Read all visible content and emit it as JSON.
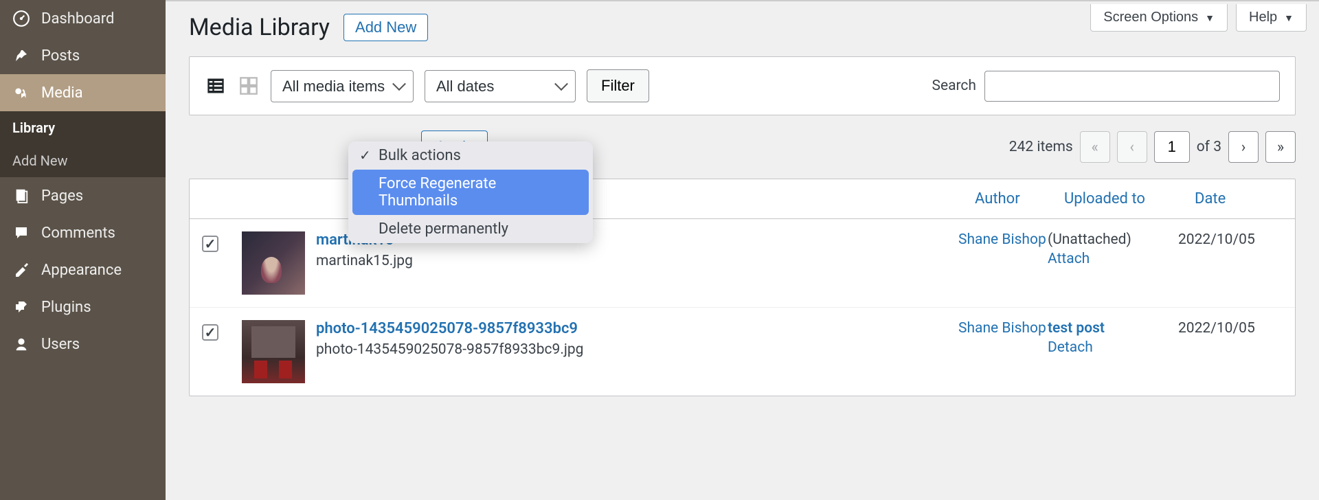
{
  "sidebar": {
    "items": [
      {
        "label": "Dashboard"
      },
      {
        "label": "Posts"
      },
      {
        "label": "Media"
      },
      {
        "label": "Pages"
      },
      {
        "label": "Comments"
      },
      {
        "label": "Appearance"
      },
      {
        "label": "Plugins"
      },
      {
        "label": "Users"
      }
    ],
    "sub": [
      {
        "label": "Library"
      },
      {
        "label": "Add New"
      }
    ]
  },
  "top": {
    "screen_options": "Screen Options",
    "help": "Help"
  },
  "header": {
    "title": "Media Library",
    "add_new": "Add New"
  },
  "filters": {
    "media_items": "All media items",
    "dates": "All dates",
    "filter_btn": "Filter",
    "search_label": "Search"
  },
  "bulk_dropdown": {
    "items": [
      {
        "label": "Bulk actions",
        "checked": true
      },
      {
        "label": "Force Regenerate Thumbnails",
        "highlighted": true
      },
      {
        "label": "Delete permanently"
      }
    ]
  },
  "actions": {
    "apply": "Apply",
    "items_count": "242 items",
    "page_current": "1",
    "of_text": "of 3"
  },
  "table": {
    "headers": {
      "author": "Author",
      "uploaded": "Uploaded to",
      "date": "Date"
    },
    "rows": [
      {
        "checked": true,
        "title": "martinak15",
        "filename": "martinak15.jpg",
        "author": "Shane Bishop",
        "uploaded_text": "(Unattached)",
        "uploaded_action": "Attach",
        "date": "2022/10/05"
      },
      {
        "checked": true,
        "title": "photo-1435459025078-9857f8933bc9",
        "filename": "photo-1435459025078-9857f8933bc9.jpg",
        "author": "Shane Bishop",
        "uploaded_link": "test post",
        "uploaded_action": "Detach",
        "date": "2022/10/05"
      }
    ]
  }
}
